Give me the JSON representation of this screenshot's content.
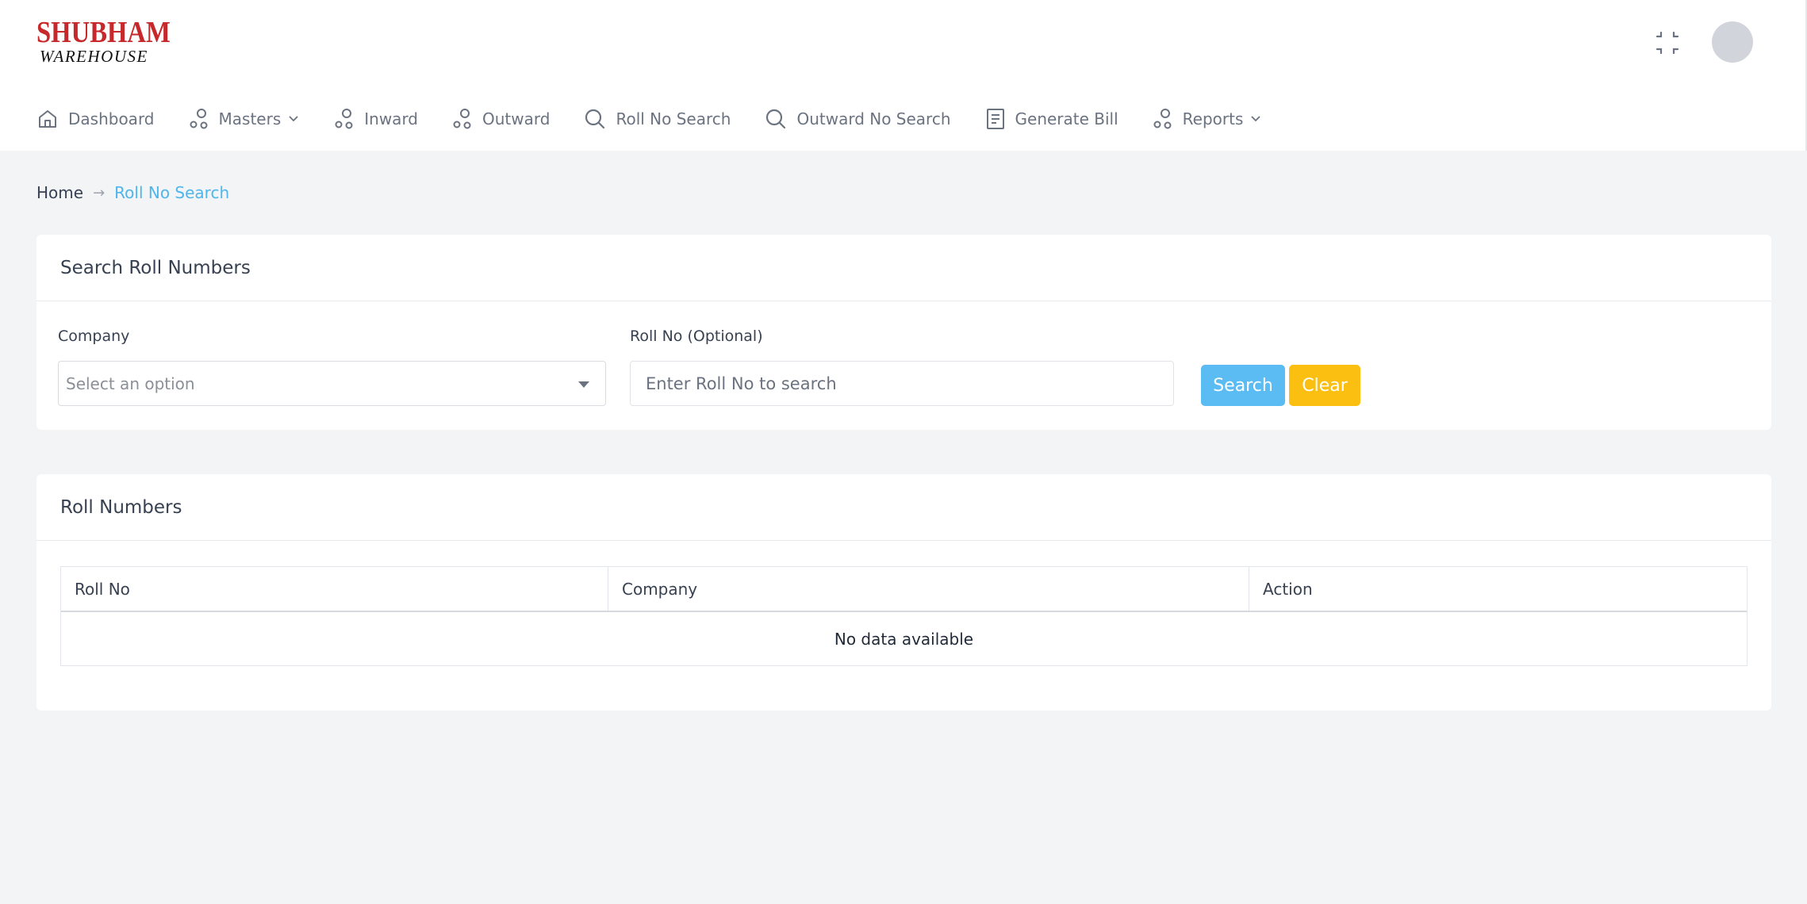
{
  "brand": {
    "line1": "SHUBHAM",
    "line2": "WAREHOUSE"
  },
  "nav": {
    "items": [
      {
        "label": "Dashboard",
        "icon": "home-icon"
      },
      {
        "label": "Masters",
        "icon": "nodes-icon",
        "dropdown": true
      },
      {
        "label": "Inward",
        "icon": "nodes-icon"
      },
      {
        "label": "Outward",
        "icon": "nodes-icon"
      },
      {
        "label": "Roll No Search",
        "icon": "search-icon"
      },
      {
        "label": "Outward No Search",
        "icon": "search-icon"
      },
      {
        "label": "Generate Bill",
        "icon": "document-icon"
      },
      {
        "label": "Reports",
        "icon": "nodes-icon",
        "dropdown": true
      }
    ]
  },
  "breadcrumb": {
    "home": "Home",
    "separator": "→",
    "current": "Roll No Search"
  },
  "search_card": {
    "title": "Search Roll Numbers",
    "company_label": "Company",
    "company_placeholder": "Select an option",
    "roll_label": "Roll No (Optional)",
    "roll_placeholder": "Enter Roll No to search",
    "search_button": "Search",
    "clear_button": "Clear"
  },
  "roll_card": {
    "title": "Roll Numbers",
    "columns": [
      "Roll No",
      "Company",
      "Action"
    ],
    "empty_message": "No data available"
  },
  "colors": {
    "accent": "#4fb5ec",
    "search_button": "#5bbcf4",
    "clear_button": "#fbbf12",
    "brand_red": "#c6282b"
  }
}
